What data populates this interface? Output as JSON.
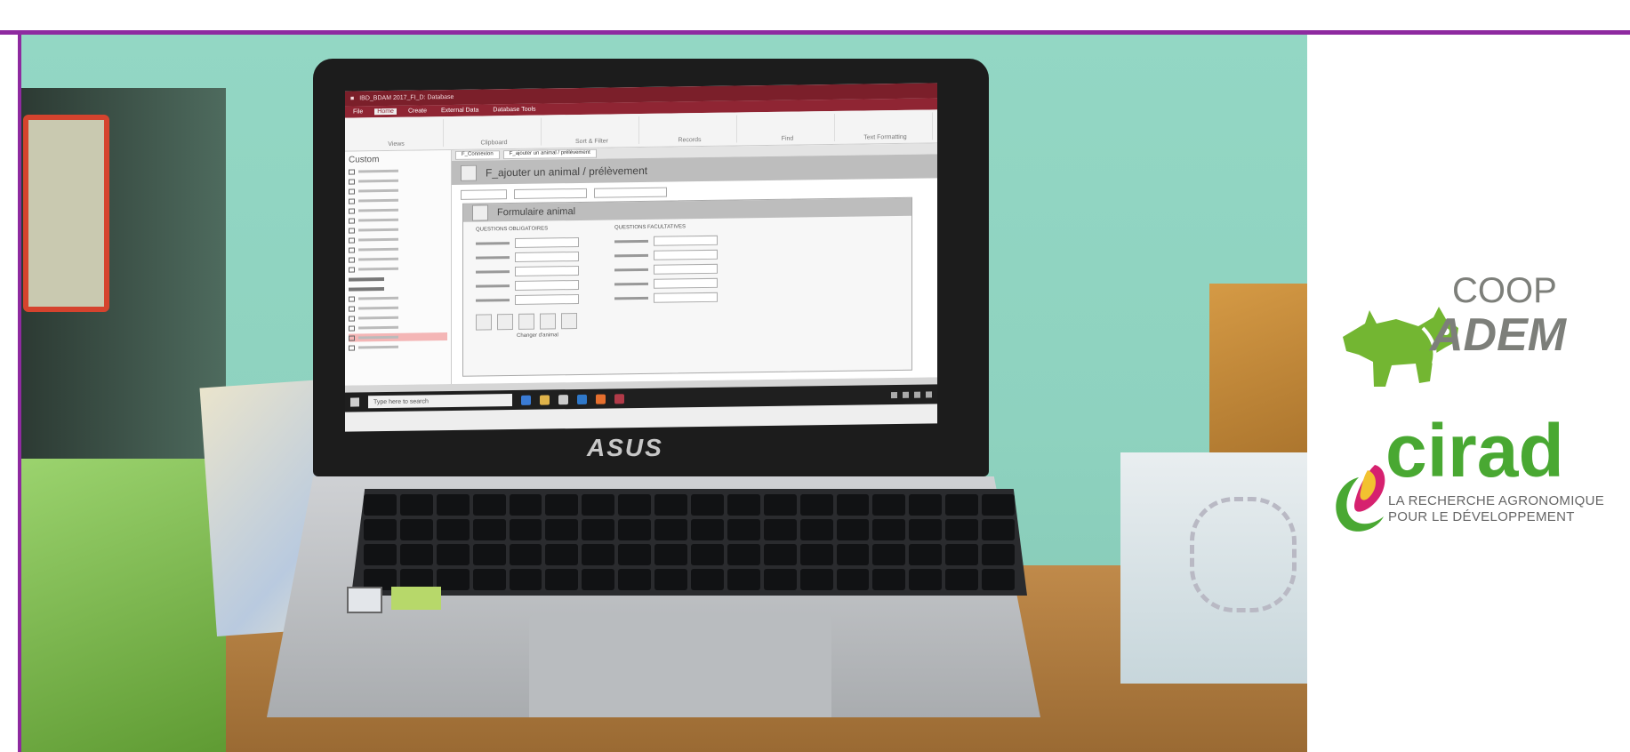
{
  "screen": {
    "title_bar": "IBD_BDAM 2017_FI_D: Database",
    "menu": [
      "File",
      "Home",
      "Create",
      "External Data",
      "Database Tools"
    ],
    "menu_active": "Home",
    "ribbon_groups": [
      "Views",
      "Clipboard",
      "Sort & Filter",
      "Records",
      "Find",
      "Text Formatting"
    ],
    "nav_pane_title": "Custom",
    "form_tabs": [
      "F_Connexion",
      "F_ajouter un animal / prélèvement"
    ],
    "form_header": "F_ajouter un animal / prélèvement",
    "subform_header": "Formulaire animal",
    "subform_col_left": "QUESTIONS OBLIGATOIRES",
    "subform_col_right": "QUESTIONS FACULTATIVES",
    "subform_footer": "Changer d'animal",
    "taskbar_search": "Type here to search"
  },
  "laptop_brand": "ASUS",
  "logos": {
    "coop_line1": "COOP",
    "coop_line2": "ADEM",
    "cirad": "cirad",
    "cirad_tagline_1": "LA RECHERCHE AGRONOMIQUE",
    "cirad_tagline_2": "POUR LE DÉVELOPPEMENT"
  },
  "colors": {
    "frame_border": "#8e2aa0",
    "coop_green": "#73b632",
    "coop_gray": "#7d7f7a",
    "cirad_green": "#49a832",
    "cirad_pink": "#d6216f"
  }
}
